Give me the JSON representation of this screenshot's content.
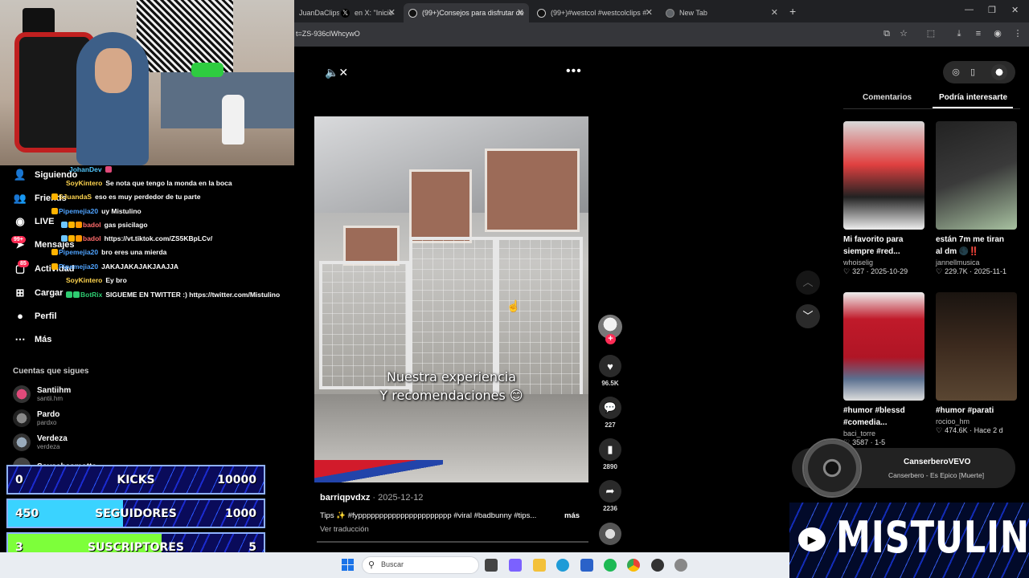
{
  "browser": {
    "tabs": [
      {
        "label": "JuanDaClips04",
        "active": false
      },
      {
        "label": "en X: \"Inicio",
        "active": false
      },
      {
        "label": "(99+)Consejos para disfrutar de",
        "active": true
      },
      {
        "label": "(99+)#westcol #westcolclips #",
        "active": false
      },
      {
        "label": "New Tab",
        "active": false
      }
    ],
    "new_tab": "+",
    "url": "t=ZS-936clWhcywO"
  },
  "sidebar": {
    "items": [
      {
        "label": "Siguiendo",
        "icon": "person-icon"
      },
      {
        "label": "Friends",
        "icon": "friends-icon"
      },
      {
        "label": "LIVE",
        "icon": "live-icon"
      },
      {
        "label": "Mensajes",
        "icon": "send-icon",
        "badge": "99+"
      },
      {
        "label": "Actividad",
        "icon": "inbox-icon",
        "badge": "85"
      },
      {
        "label": "Cargar",
        "icon": "plus-box-icon"
      },
      {
        "label": "Perfil",
        "icon": "profile-icon"
      },
      {
        "label": "Más",
        "icon": "ellipsis-icon"
      }
    ],
    "following_title": "Cuentas que sigues",
    "accounts": [
      {
        "name": "Santiihm",
        "handle": "santii.hm"
      },
      {
        "name": "Pardo",
        "handle": "pardxo"
      },
      {
        "name": "Verdeza",
        "handle": "verdeza"
      },
      {
        "name": "Soysebasmotta",
        "handle": ""
      }
    ]
  },
  "chat": [
    {
      "user": "JohanDev",
      "msg": "",
      "color": "#4fc3f7"
    },
    {
      "user": "SoyKintero",
      "msg": "Se nota que tengo la monda en la boca",
      "color": "#ffd54f"
    },
    {
      "user": "SJuandaS",
      "msg": "eso es muy perdedor de tu parte",
      "color": "#ffd54f"
    },
    {
      "user": "Pipemejia20",
      "msg": "uy Mistulino",
      "color": "#4fa3ff"
    },
    {
      "user": "badol",
      "msg": "gas psicilago",
      "color": "#ff6b6b"
    },
    {
      "user": "badol",
      "msg": "https://vt.tiktok.com/ZS5KBpLCv/",
      "color": "#ff6b6b"
    },
    {
      "user": "Pipemejia20",
      "msg": "bro eres una mierda",
      "color": "#4fa3ff"
    },
    {
      "user": "Pipemejia20",
      "msg": "JAKAJAKAJAKJAAJJA",
      "color": "#4fa3ff"
    },
    {
      "user": "SoyKintero",
      "msg": "Ey bro",
      "color": "#ffd54f"
    },
    {
      "user": "BotRix",
      "msg": "SIGUEME EN TWITTER :) https://twitter.com/Mistulino",
      "color": "#2ecc71"
    }
  ],
  "counters": [
    {
      "left": "0",
      "title": "KICKS",
      "right": "10000",
      "progress": 0.0,
      "fill": "#3ad3ff"
    },
    {
      "left": "450",
      "title": "SEGUIDORES",
      "right": "1000",
      "progress": 0.45,
      "fill": "#3ad3ff"
    },
    {
      "left": "3",
      "title": "SUSCRIPTORES",
      "right": "5",
      "progress": 0.6,
      "fill": "#7dff3a"
    }
  ],
  "video": {
    "caption_line1": "Nuestra experiencia",
    "caption_line2": "Y recomendaciones 😊",
    "author": "barriqpvdxz",
    "date": "2025-12-12",
    "description": "Tips ✨ #fypppppppppppppppppppppp #viral #badbunny #tips...",
    "more": "más",
    "translate": "Ver traducción"
  },
  "actions": {
    "likes": "96.5K",
    "comments": "227",
    "saves": "2890",
    "shares": "2236"
  },
  "right_panel": {
    "tab_comments": "Comentarios",
    "tab_suggest": "Podría interesarte",
    "cards": [
      {
        "title1": "Mi favorito para",
        "title2": "siempre #red...",
        "author": "whoiselig",
        "likes": "327",
        "date": "2025-10-29"
      },
      {
        "title1": "están 7m me tiran",
        "title2": "al dm 🌑‼️",
        "author": "jannellmusica",
        "likes": "229.7K",
        "date": "2025-11-1"
      },
      {
        "title1": "#humor #blessd",
        "title2": "#comedia...",
        "author": "baci_torre",
        "likes": "3587",
        "date": "1-5"
      },
      {
        "title1": "#humor #parati",
        "title2": "",
        "author": "rocioo_hm",
        "likes": "474.6K",
        "date": "Hace 2 d"
      }
    ]
  },
  "music": {
    "artist": "CanserberoVEVO",
    "track": "Canserbero - Es Epico [Muerte]"
  },
  "brand": {
    "name": "MISTULINO"
  },
  "taskbar": {
    "search_placeholder": "Buscar"
  }
}
